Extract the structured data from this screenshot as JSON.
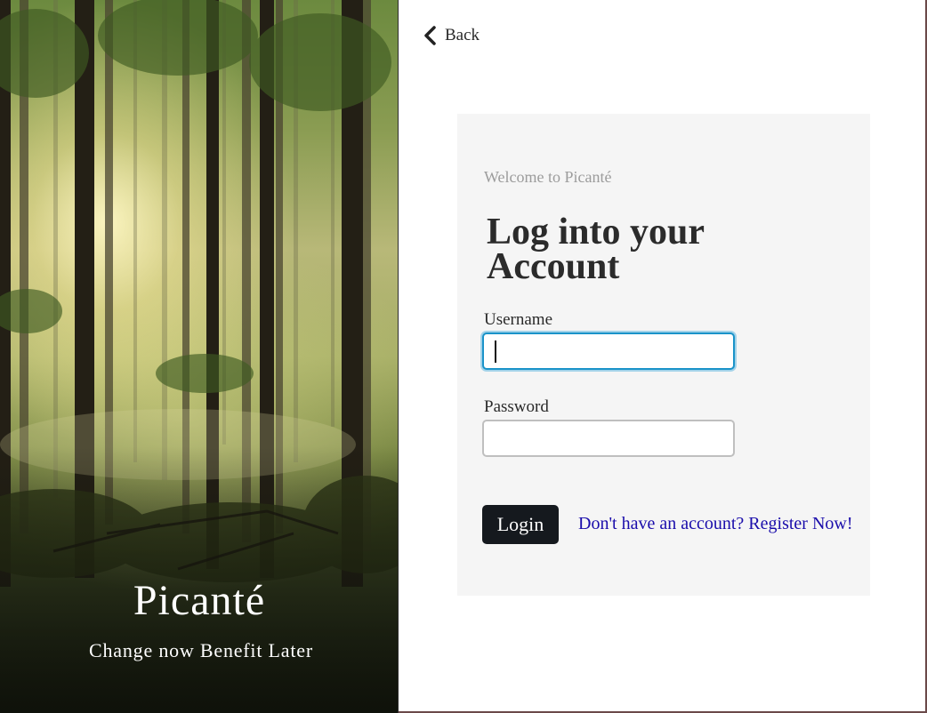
{
  "hero": {
    "brand": "Picanté",
    "tagline": "Change now Benefit Later"
  },
  "nav": {
    "back_label": "Back",
    "back_icon": "chevron-left-icon"
  },
  "login": {
    "welcome": "Welcome to Picanté",
    "heading": "Log into your Account",
    "username_label": "Username",
    "username_value": "",
    "password_label": "Password",
    "password_value": "",
    "login_button": "Login",
    "register_link": "Don't have an account? Register Now!"
  },
  "colors": {
    "card_background": "#f5f5f5",
    "focus_border": "#1a93c9",
    "button_background": "#15191e",
    "link": "#1a0dab",
    "welcome_text": "#9c9c9c"
  }
}
